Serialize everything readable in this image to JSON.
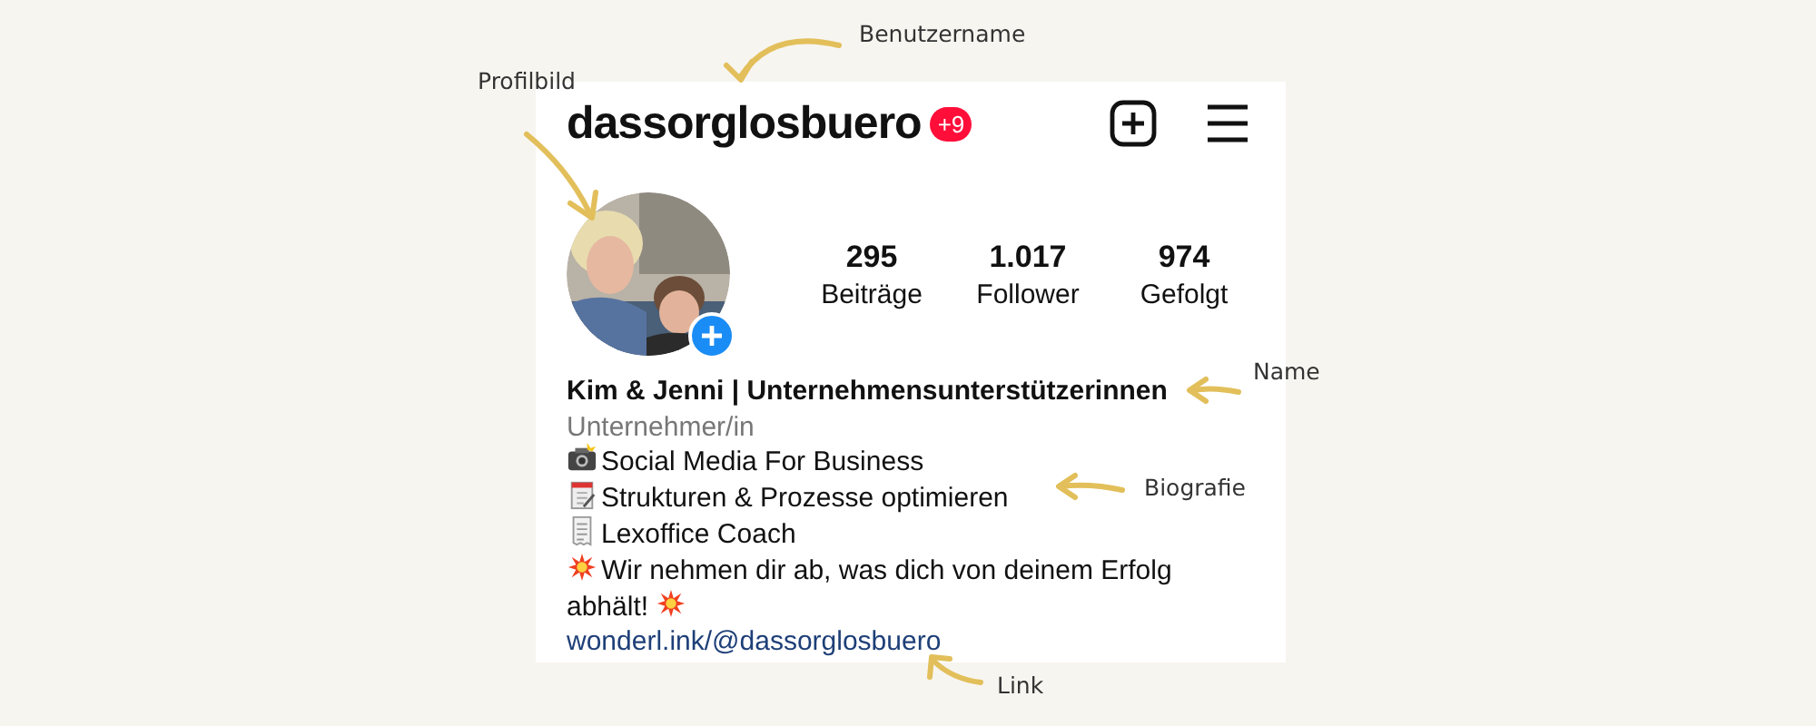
{
  "header": {
    "username": "dassorglosbuero",
    "notification_badge": "+9"
  },
  "stats": [
    {
      "value": "295",
      "label": "Beiträge"
    },
    {
      "value": "1.017",
      "label": "Follower"
    },
    {
      "value": "974",
      "label": "Gefolgt"
    }
  ],
  "name": "Kim & Jenni | Unternehmensunterstützerinnen",
  "category": "Unternehmer/in",
  "bio": [
    {
      "parts": [
        {
          "kind": "camera"
        },
        {
          "kind": "text",
          "text": "Social Media For Business"
        }
      ]
    },
    {
      "parts": [
        {
          "kind": "notepad"
        },
        {
          "kind": "text",
          "text": "Strukturen & Prozesse optimieren"
        }
      ]
    },
    {
      "parts": [
        {
          "kind": "receipt"
        },
        {
          "kind": "text",
          "text": "Lexoffice Coach"
        }
      ]
    },
    {
      "parts": [
        {
          "kind": "explosion"
        },
        {
          "kind": "text",
          "text": "Wir nehmen dir ab, was dich von deinem Erfolg"
        }
      ]
    },
    {
      "parts": [
        {
          "kind": "text",
          "text": "abhält!"
        },
        {
          "kind": "explosion"
        }
      ]
    }
  ],
  "link": "wonderl.ink/@dassorglosbuero",
  "annotations": [
    {
      "label": "Benutzername"
    },
    {
      "label": "Profilbild"
    },
    {
      "label": "Name"
    },
    {
      "label": "Biografie"
    },
    {
      "label": "Link"
    }
  ]
}
